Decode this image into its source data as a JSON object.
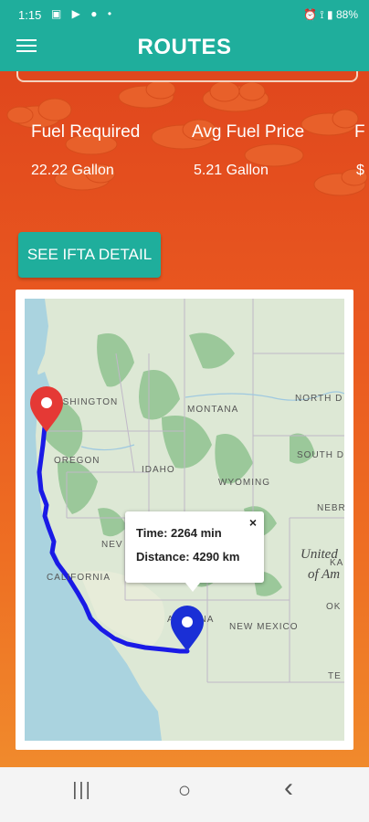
{
  "status_bar": {
    "time": "1:15",
    "left_icons": "▣ ▶ ● •",
    "right_icons": "⏰ ⟟ ▮ 88%",
    "battery": "88%"
  },
  "app_bar": {
    "title": "ROUTES",
    "menu_icon": "hamburger-menu-icon"
  },
  "stats": [
    {
      "label": "Fuel Required",
      "value": "22.22 Gallon"
    },
    {
      "label": "Avg Fuel Price",
      "value": "5.21 Gallon"
    },
    {
      "label": "F",
      "value": "$"
    }
  ],
  "buttons": {
    "ifta": "SEE IFTA DETAIL"
  },
  "map": {
    "labels": {
      "washington": "ASHINGTON",
      "oregon": "OREGON",
      "idaho": "IDAHO",
      "montana": "MONTANA",
      "wyoming": "WYOMING",
      "north_dakota": "NORTH D",
      "south_dakota": "SOUTH D",
      "nebraska": "NEBR",
      "nevada": "NEV",
      "california": "CALIFORNIA",
      "arizona": "ARIZONA",
      "new_mexico": "NEW MEXICO",
      "united_states": "United",
      "of_america": "of Am",
      "oklahoma": "OK",
      "texas": "TE",
      "kansas": "KA"
    },
    "info_window": {
      "time": "Time: 2264 min",
      "distance": "Distance: 4290 km",
      "close": "×"
    },
    "colors": {
      "route": "#1a1ae6",
      "origin_marker": "#e53935",
      "destination_marker": "#1a2fd6",
      "water": "#aad3df",
      "land": "#dde8d5",
      "forest": "#9bc89a"
    }
  },
  "nav_bar": {
    "recent": "|||",
    "home": "○",
    "back": "‹"
  }
}
